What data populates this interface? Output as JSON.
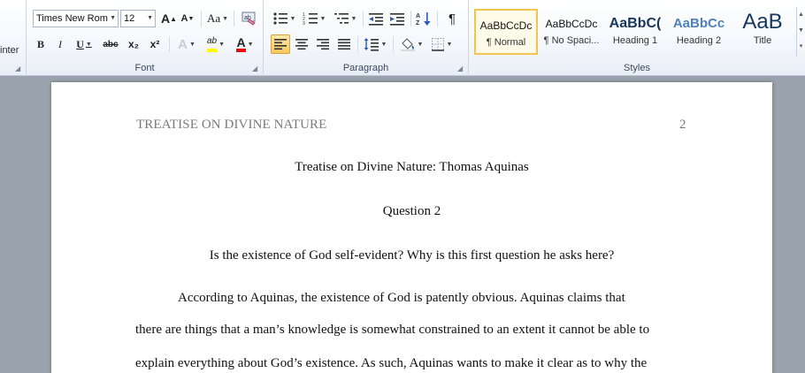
{
  "ribbon": {
    "clipboard": {
      "label": "inter"
    },
    "font": {
      "group_label": "Font",
      "font_name": "Times New Rom",
      "font_size": "12",
      "grow_label": "A",
      "shrink_label": "A",
      "case_label": "Aa",
      "bold": "B",
      "italic": "I",
      "underline": "U",
      "strike": "abc",
      "subscript": "x₂",
      "superscript": "x²",
      "effects": "A",
      "highlight": "ab",
      "font_color": "A"
    },
    "paragraph": {
      "group_label": "Paragraph",
      "pilcrow": "¶"
    },
    "styles": {
      "group_label": "Styles",
      "tiles": [
        {
          "preview": "AaBbCcDc",
          "name": "¶ Normal"
        },
        {
          "preview": "AaBbCcDc",
          "name": "¶ No Spaci..."
        },
        {
          "preview": "AaBbC(",
          "name": "Heading 1"
        },
        {
          "preview": "AaBbCc",
          "name": "Heading 2"
        },
        {
          "preview": "AaB",
          "name": "Title"
        }
      ]
    }
  },
  "colors": {
    "highlight": "#ffff00",
    "font_color": "#ff0000",
    "heading_blue": "#17365d",
    "accent": "#f2c552"
  },
  "document": {
    "header_title": "TREATISE ON DIVINE NATURE",
    "page_number": "2",
    "title": "Treatise on Divine Nature: Thomas Aquinas",
    "question": "Question 2",
    "prompt": "Is the existence of God self-evident? Why is this first question he asks here?",
    "lines": [
      "According to Aquinas, the existence of God is patently obvious. Aquinas claims that",
      "there are things that a man’s knowledge is somewhat constrained to an extent it cannot be able to",
      "explain everything about God’s existence. As such, Aquinas wants to make it clear as to why the"
    ]
  }
}
